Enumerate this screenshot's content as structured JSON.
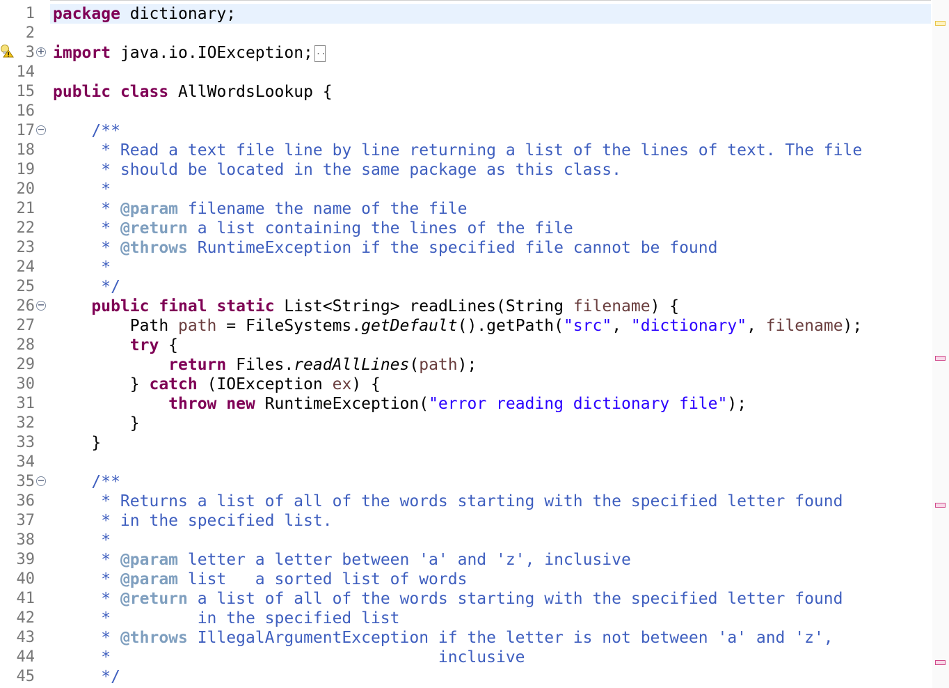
{
  "editor": {
    "lines": [
      {
        "n": "1",
        "segs": [
          {
            "t": "package",
            "c": "kw"
          },
          {
            "t": " dictionary;",
            "c": ""
          }
        ]
      },
      {
        "n": "2",
        "segs": []
      },
      {
        "n": "3",
        "fold": "+",
        "folded": true,
        "segs": [
          {
            "t": "import",
            "c": "kw"
          },
          {
            "t": " java.io.IOException;",
            "c": ""
          }
        ]
      },
      {
        "n": "14",
        "segs": []
      },
      {
        "n": "15",
        "segs": [
          {
            "t": "public",
            "c": "kw"
          },
          {
            "t": " ",
            "c": ""
          },
          {
            "t": "class",
            "c": "kw"
          },
          {
            "t": " AllWordsLookup {",
            "c": ""
          }
        ]
      },
      {
        "n": "16",
        "segs": []
      },
      {
        "n": "17",
        "fold": "−",
        "segs": [
          {
            "t": "    /**",
            "c": "jd"
          }
        ]
      },
      {
        "n": "18",
        "segs": [
          {
            "t": "     * Read a text file line by line returning a list of the lines of text. The file",
            "c": "jd"
          }
        ]
      },
      {
        "n": "19",
        "segs": [
          {
            "t": "     * should be located in the same package as this class.",
            "c": "jd"
          }
        ]
      },
      {
        "n": "20",
        "segs": [
          {
            "t": "     *",
            "c": "jd"
          }
        ]
      },
      {
        "n": "21",
        "segs": [
          {
            "t": "     * ",
            "c": "jd"
          },
          {
            "t": "@param",
            "c": "tag"
          },
          {
            "t": " filename the name of the file",
            "c": "jd"
          }
        ]
      },
      {
        "n": "22",
        "segs": [
          {
            "t": "     * ",
            "c": "jd"
          },
          {
            "t": "@return",
            "c": "tag"
          },
          {
            "t": " a list containing the lines of the file",
            "c": "jd"
          }
        ]
      },
      {
        "n": "23",
        "segs": [
          {
            "t": "     * ",
            "c": "jd"
          },
          {
            "t": "@throws",
            "c": "tag"
          },
          {
            "t": " RuntimeException if the specified file cannot be found",
            "c": "jd"
          }
        ]
      },
      {
        "n": "24",
        "segs": [
          {
            "t": "     *",
            "c": "jd"
          }
        ]
      },
      {
        "n": "25",
        "segs": [
          {
            "t": "     */",
            "c": "jd"
          }
        ]
      },
      {
        "n": "26",
        "fold": "−",
        "segs": [
          {
            "t": "    ",
            "c": ""
          },
          {
            "t": "public",
            "c": "kw"
          },
          {
            "t": " ",
            "c": ""
          },
          {
            "t": "final",
            "c": "kw"
          },
          {
            "t": " ",
            "c": ""
          },
          {
            "t": "static",
            "c": "kw"
          },
          {
            "t": " List<String> readLines(String ",
            "c": ""
          },
          {
            "t": "filename",
            "c": "var"
          },
          {
            "t": ") {",
            "c": ""
          }
        ]
      },
      {
        "n": "27",
        "segs": [
          {
            "t": "        Path ",
            "c": ""
          },
          {
            "t": "path",
            "c": "var"
          },
          {
            "t": " = FileSystems.",
            "c": ""
          },
          {
            "t": "getDefault",
            "c": "it"
          },
          {
            "t": "().getPath(",
            "c": ""
          },
          {
            "t": "\"src\"",
            "c": "str"
          },
          {
            "t": ", ",
            "c": ""
          },
          {
            "t": "\"dictionary\"",
            "c": "str"
          },
          {
            "t": ", ",
            "c": ""
          },
          {
            "t": "filename",
            "c": "var"
          },
          {
            "t": ");",
            "c": ""
          }
        ]
      },
      {
        "n": "28",
        "segs": [
          {
            "t": "        ",
            "c": ""
          },
          {
            "t": "try",
            "c": "kw"
          },
          {
            "t": " {",
            "c": ""
          }
        ]
      },
      {
        "n": "29",
        "segs": [
          {
            "t": "            ",
            "c": ""
          },
          {
            "t": "return",
            "c": "kw"
          },
          {
            "t": " Files.",
            "c": ""
          },
          {
            "t": "readAllLines",
            "c": "it"
          },
          {
            "t": "(",
            "c": ""
          },
          {
            "t": "path",
            "c": "var"
          },
          {
            "t": ");",
            "c": ""
          }
        ]
      },
      {
        "n": "30",
        "segs": [
          {
            "t": "        } ",
            "c": ""
          },
          {
            "t": "catch",
            "c": "kw"
          },
          {
            "t": " (IOException ",
            "c": ""
          },
          {
            "t": "ex",
            "c": "var"
          },
          {
            "t": ") {",
            "c": ""
          }
        ]
      },
      {
        "n": "31",
        "segs": [
          {
            "t": "            ",
            "c": ""
          },
          {
            "t": "throw",
            "c": "kw"
          },
          {
            "t": " ",
            "c": ""
          },
          {
            "t": "new",
            "c": "kw"
          },
          {
            "t": " RuntimeException(",
            "c": ""
          },
          {
            "t": "\"error reading dictionary file\"",
            "c": "str"
          },
          {
            "t": ");",
            "c": ""
          }
        ]
      },
      {
        "n": "32",
        "segs": [
          {
            "t": "        }",
            "c": ""
          }
        ]
      },
      {
        "n": "33",
        "segs": [
          {
            "t": "    }",
            "c": ""
          }
        ]
      },
      {
        "n": "34",
        "segs": []
      },
      {
        "n": "35",
        "fold": "−",
        "segs": [
          {
            "t": "    /**",
            "c": "jd"
          }
        ]
      },
      {
        "n": "36",
        "segs": [
          {
            "t": "     * Returns a list of all of the words starting with the specified letter found",
            "c": "jd"
          }
        ]
      },
      {
        "n": "37",
        "segs": [
          {
            "t": "     * in the specified list.",
            "c": "jd"
          }
        ]
      },
      {
        "n": "38",
        "segs": [
          {
            "t": "     *",
            "c": "jd"
          }
        ]
      },
      {
        "n": "39",
        "segs": [
          {
            "t": "     * ",
            "c": "jd"
          },
          {
            "t": "@param",
            "c": "tag"
          },
          {
            "t": " letter a letter between 'a' and 'z', inclusive",
            "c": "jd"
          }
        ]
      },
      {
        "n": "40",
        "segs": [
          {
            "t": "     * ",
            "c": "jd"
          },
          {
            "t": "@param",
            "c": "tag"
          },
          {
            "t": " list   a sorted list of words",
            "c": "jd"
          }
        ]
      },
      {
        "n": "41",
        "segs": [
          {
            "t": "     * ",
            "c": "jd"
          },
          {
            "t": "@return",
            "c": "tag"
          },
          {
            "t": " a list of all of the words starting with the specified letter found",
            "c": "jd"
          }
        ]
      },
      {
        "n": "42",
        "segs": [
          {
            "t": "     *         in the specified list",
            "c": "jd"
          }
        ]
      },
      {
        "n": "43",
        "segs": [
          {
            "t": "     * ",
            "c": "jd"
          },
          {
            "t": "@throws",
            "c": "tag"
          },
          {
            "t": " IllegalArgumentException if the letter is not between 'a' and 'z',",
            "c": "jd"
          }
        ]
      },
      {
        "n": "44",
        "segs": [
          {
            "t": "     *                                  inclusive",
            "c": "jd"
          }
        ]
      },
      {
        "n": "45",
        "segs": [
          {
            "t": "     */",
            "c": "jd"
          }
        ]
      }
    ]
  },
  "icons": {
    "warning": "warning-lightbulb-icon",
    "fold_expand": "fold-expand-icon",
    "fold_collapse": "fold-collapse-icon"
  },
  "colors": {
    "keyword": "#7f0055",
    "javadoc": "#3f5fbf",
    "javadoc_tag": "#7f9fbf",
    "string": "#2a00ff",
    "variable": "#6a3e3e",
    "line_number": "#787878",
    "current_line": "#e8f2fe",
    "overview_warning": "#e8c44a",
    "overview_occurrence": "#d04a8a"
  },
  "overview_marks": [
    {
      "kind": "warning"
    },
    {
      "kind": "occurrence"
    },
    {
      "kind": "occurrence"
    },
    {
      "kind": "occurrence"
    }
  ]
}
